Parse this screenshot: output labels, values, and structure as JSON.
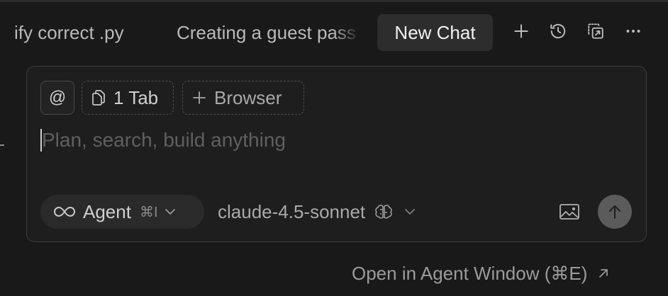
{
  "tabs": [
    {
      "label": "ify correct .py",
      "active": false
    },
    {
      "label": "Creating a guest pass",
      "active": false
    },
    {
      "label": "New Chat",
      "active": true
    }
  ],
  "toolbar_icons": [
    "plus-icon",
    "history-icon",
    "duplicate-window-icon",
    "more-icon"
  ],
  "composer": {
    "mention_symbol": "@",
    "context_chip": {
      "icon": "files-icon",
      "label": "1 Tab"
    },
    "browser_chip": {
      "icon": "plus-icon",
      "label": "Browser"
    },
    "placeholder": "Plan, search, build anything",
    "mode": {
      "icon": "infinity-icon",
      "label": "Agent",
      "shortcut": "⌘I"
    },
    "model": {
      "label": "claude-4.5-sonnet",
      "icon": "brain-icon"
    },
    "image_button_icon": "image-icon",
    "send_button_icon": "arrow-up-icon"
  },
  "footer": {
    "open_agent_label": "Open in Agent Window (⌘E)",
    "open_agent_icon": "arrow-up-right-icon"
  },
  "colors": {
    "background": "#191919",
    "composer_bg": "#1e1e1e",
    "active_tab_bg": "#2d2d2d",
    "send_button": "#5b5b5b"
  }
}
